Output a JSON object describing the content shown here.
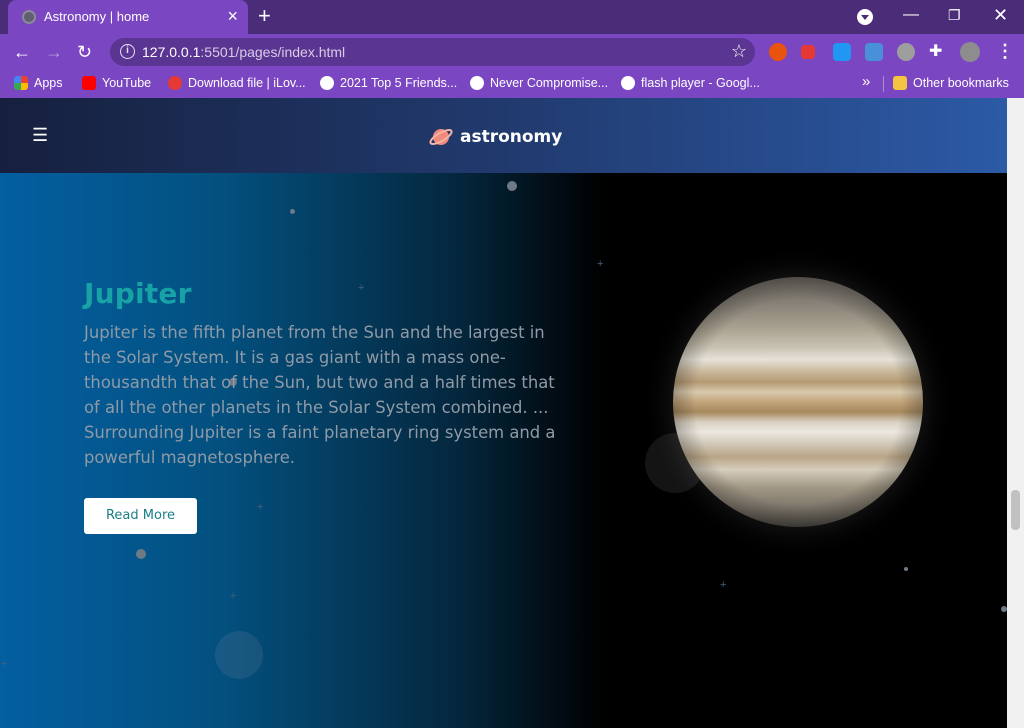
{
  "browser": {
    "tab_title": "Astronomy | home",
    "url_host": "127.0.0.1",
    "url_path": ":5501/pages/index.html",
    "bookmarks": [
      {
        "label": "Apps",
        "icon": "apps-grid-icon",
        "color": "#4285f4"
      },
      {
        "label": "YouTube",
        "icon": "youtube-icon",
        "color": "#ff0000"
      },
      {
        "label": "Download file | iLov...",
        "icon": "heart-icon",
        "color": "#e53935"
      },
      {
        "label": "2021 Top 5 Friends...",
        "icon": "globe-icon",
        "color": "#ffffff"
      },
      {
        "label": "Never Compromise...",
        "icon": "shield-icon",
        "color": "#ffffff"
      },
      {
        "label": "flash player - Googl...",
        "icon": "google-icon",
        "color": "#ffffff"
      }
    ],
    "other_bookmarks": "Other bookmarks"
  },
  "site": {
    "brand": "astronomy",
    "accent": "#17a3a6"
  },
  "hero": {
    "title": "Jupiter",
    "description": "Jupiter is the fifth planet from the Sun and the largest in the Solar System. It is a gas giant with a mass one-thousandth that of the Sun, but two and a half times that of all the other planets in the Solar System combined. ... Surrounding Jupiter is a faint planetary ring system and a powerful magnetosphere.",
    "button_label": "Read More"
  }
}
